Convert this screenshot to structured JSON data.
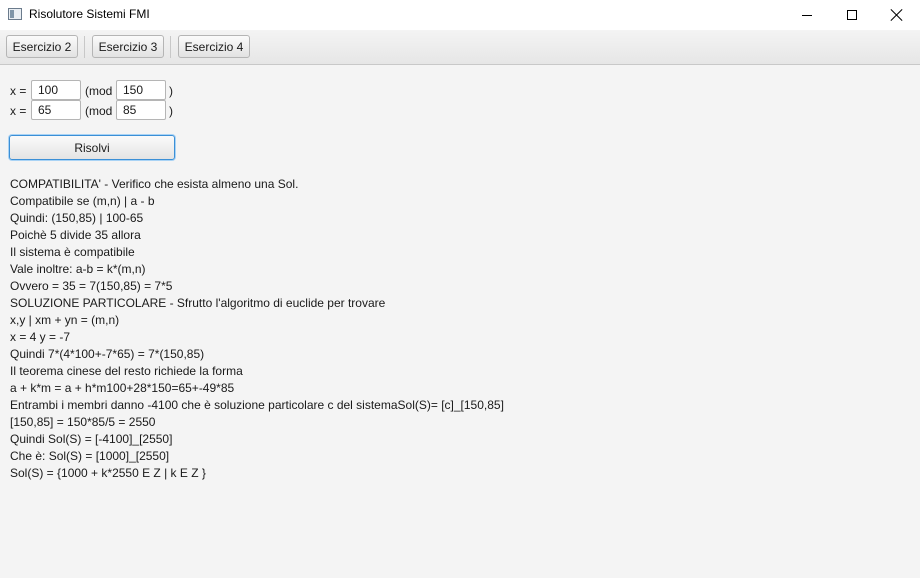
{
  "window": {
    "title": "Risolutore Sistemi FMI"
  },
  "toolbar": {
    "buttons": [
      "Esercizio 2",
      "Esercizio 3",
      "Esercizio 4"
    ]
  },
  "form": {
    "rows": [
      {
        "x_label": "x =",
        "a": "100",
        "mod_label": "(mod",
        "m": "150",
        "close": ")"
      },
      {
        "x_label": "x =",
        "a": "65",
        "mod_label": "(mod",
        "m": "85",
        "close": ")"
      }
    ],
    "solve_label": "Risolvi"
  },
  "output": {
    "lines": [
      "COMPATIBILITA' - Verifico che esista almeno una Sol.",
      "Compatibile se (m,n) | a - b",
      "Quindi: (150,85) | 100-65",
      "Poichè 5 divide 35 allora",
      "Il sistema è compatibile",
      "Vale inoltre: a-b = k*(m,n)",
      "Ovvero = 35 = 7(150,85) = 7*5",
      "SOLUZIONE PARTICOLARE - Sfrutto l'algoritmo di euclide per trovare",
      "x,y | xm + yn = (m,n)",
      "x = 4 y = -7",
      "Quindi 7*(4*100+-7*65) = 7*(150,85)",
      "Il teorema cinese del resto richiede la forma",
      "a + k*m = a + h*m100+28*150=65+-49*85",
      "Entrambi i membri danno -4100 che è soluzione particolare c del sistemaSol(S)= [c]_[150,85]",
      "[150,85] = 150*85/5 = 2550",
      "Quindi Sol(S) = [-4100]_[2550]",
      "Che è: Sol(S) = [1000]_[2550]",
      "Sol(S) = {1000 + k*2550 E Z | k E Z }"
    ]
  }
}
